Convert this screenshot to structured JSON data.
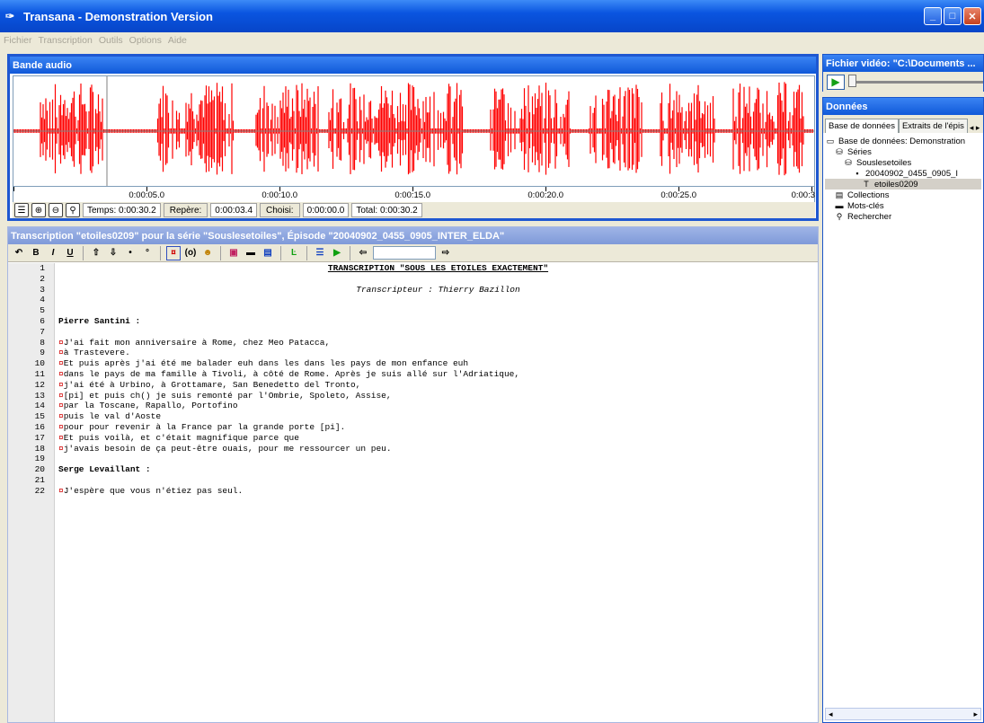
{
  "window": {
    "title": "Transana - Demonstration Version"
  },
  "menu": [
    "Fichier",
    "Transcription",
    "Outils",
    "Options",
    "Aide"
  ],
  "audio": {
    "title": "Bande audio",
    "ticks": [
      "0:00:05.0",
      "0:00:10.0",
      "0:00:15.0",
      "0:00:20.0",
      "0:00:25.0",
      "0:00:3"
    ],
    "time_label": "Temps: 0:00:30.2",
    "marker_label": "Repère:",
    "marker_value": "0:00:03.4",
    "chosen_label": "Choisi:",
    "chosen_value": "0:00:00.0",
    "total_label": "Total: 0:00:30.2",
    "wave_color": "#ff0000"
  },
  "transcript": {
    "title": "Transcription \"etoiles0209\" pour la série \"Souslesetoiles\", Épisode \"20040902_0455_0905_INTER_ELDA\"",
    "lines": [
      "TRANSCRIPTION \"SOUS LES ETOILES EXACTEMENT\"",
      "",
      "Transcripteur : Thierry Bazillon",
      "",
      "",
      "Pierre Santini :",
      "",
      "J'ai fait mon anniversaire à Rome, chez Meo Patacca,",
      "à Trastevere.",
      "Et puis après j'ai été me balader euh dans les dans les pays de mon enfance euh",
      "dans le pays de ma famille à Tivoli, à côté de Rome. Après je suis allé sur l'Adriatique,",
      "j'ai été à Urbino, à Grottamare, San Benedetto del Tronto,",
      "[pi] et puis ch() je suis remonté par l'Ombrie, Spoleto, Assise,",
      "par la Toscane, Rapallo, Portofino",
      "puis le val d'Aoste",
      "pour pour revenir à la France par la grande porte [pi].",
      "Et puis voilà, et c'était magnifique parce que",
      "j'avais besoin de ça peut-être ouais, pour me ressourcer un peu.",
      "",
      "Serge Levaillant :",
      "",
      "J'espère que vous n'étiez pas seul."
    ],
    "line_numbers": [
      "1",
      "2",
      "3",
      "4",
      "5",
      "6",
      "7",
      "8",
      "9",
      "10",
      "11",
      "12",
      "13",
      "14",
      "15",
      "16",
      "17",
      "18",
      "19",
      "20",
      "21",
      "22"
    ]
  },
  "video": {
    "title": "Fichier vidéo: \"C:\\Documents ..."
  },
  "data": {
    "title": "Données",
    "tabs": [
      "Base de données",
      "Extraits de l'épis"
    ],
    "tree": [
      {
        "label": "Base de données: Demonstration",
        "indent": 0,
        "icon": "database-icon"
      },
      {
        "label": "Séries",
        "indent": 1,
        "icon": "series-icon"
      },
      {
        "label": "Souslesetoiles",
        "indent": 2,
        "icon": "series-icon"
      },
      {
        "label": "20040902_0455_0905_I",
        "indent": 3,
        "icon": "episode-icon"
      },
      {
        "label": "etoiles0209",
        "indent": 4,
        "icon": "transcript-icon"
      },
      {
        "label": "Collections",
        "indent": 1,
        "icon": "collection-icon"
      },
      {
        "label": "Mots-clés",
        "indent": 1,
        "icon": "keyword-icon"
      },
      {
        "label": "Rechercher",
        "indent": 1,
        "icon": "search-icon"
      }
    ]
  }
}
